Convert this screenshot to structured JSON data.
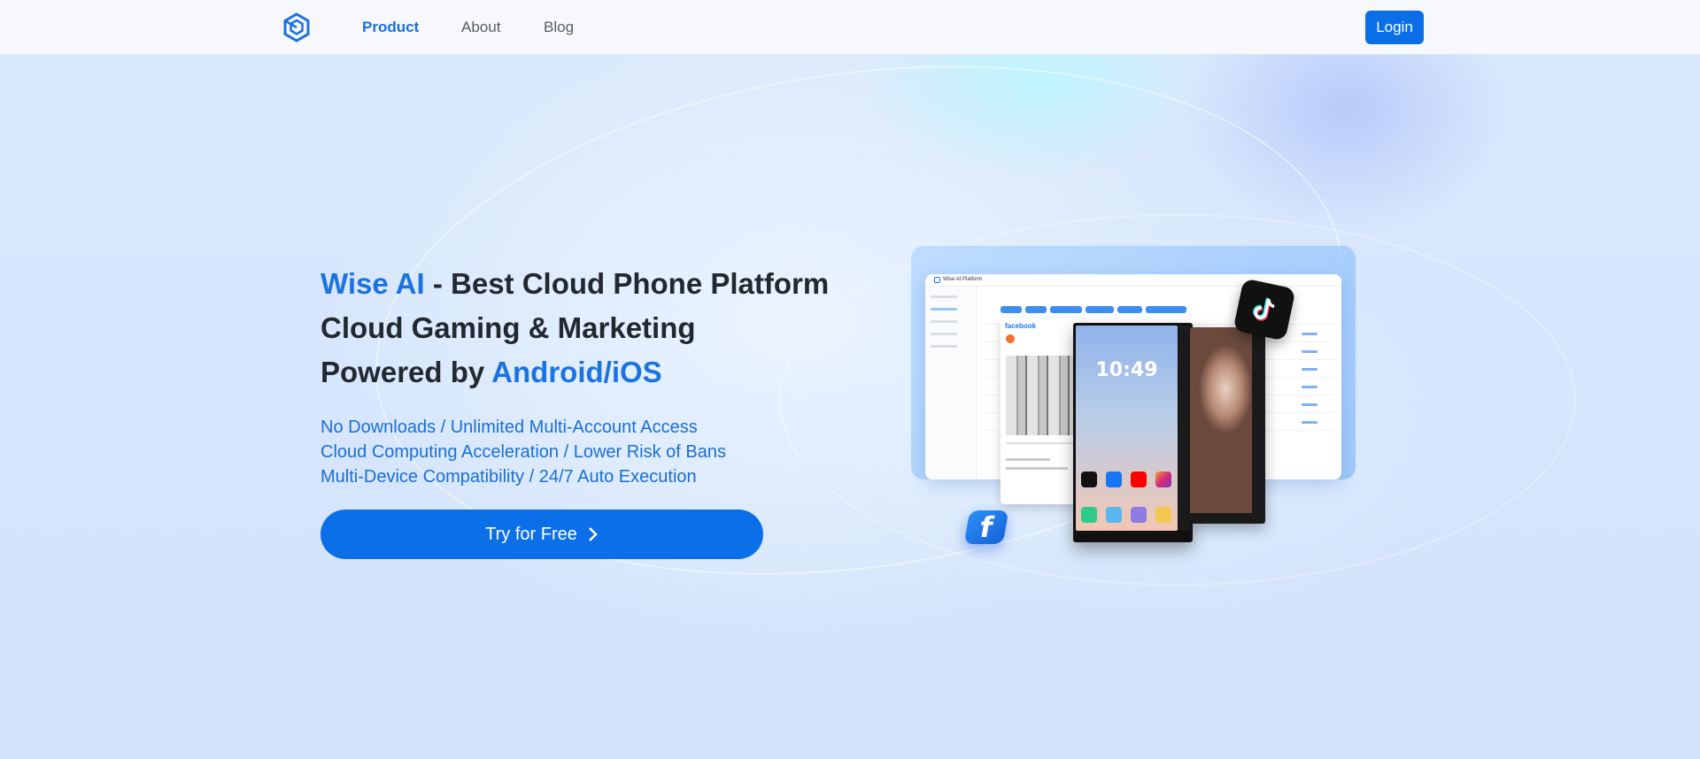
{
  "nav": {
    "logo": "wise-ai-logo-icon",
    "links": [
      {
        "label": "Product",
        "active": true
      },
      {
        "label": "About",
        "active": false
      },
      {
        "label": "Blog",
        "active": false
      }
    ],
    "login_label": "Login"
  },
  "hero": {
    "title_brand": "Wise AI",
    "title_rest": " - Best Cloud Phone Platform",
    "title_line2": "Cloud Gaming & Marketing",
    "title_line3_prefix": "Powered by ",
    "title_line3_highlight": "Android/iOS",
    "features": [
      "No Downloads / Unlimited Multi-Account Access",
      "Cloud Computing Acceleration / Lower Risk of Bans",
      "Multi-Device Compatibility / 24/7 Auto Execution"
    ],
    "cta_label": "Try for Free"
  },
  "mockup": {
    "dashboard_title": "Wise AI Platform",
    "fb_brand": "facebook",
    "phone_time": "10:49",
    "badges": [
      "tiktok-icon",
      "facebook-icon"
    ]
  },
  "colors": {
    "accent": "#0a6fe6",
    "text_dark": "#22282f",
    "feature_text": "#1a6fd6",
    "page_bg": "#d4e4fb"
  }
}
